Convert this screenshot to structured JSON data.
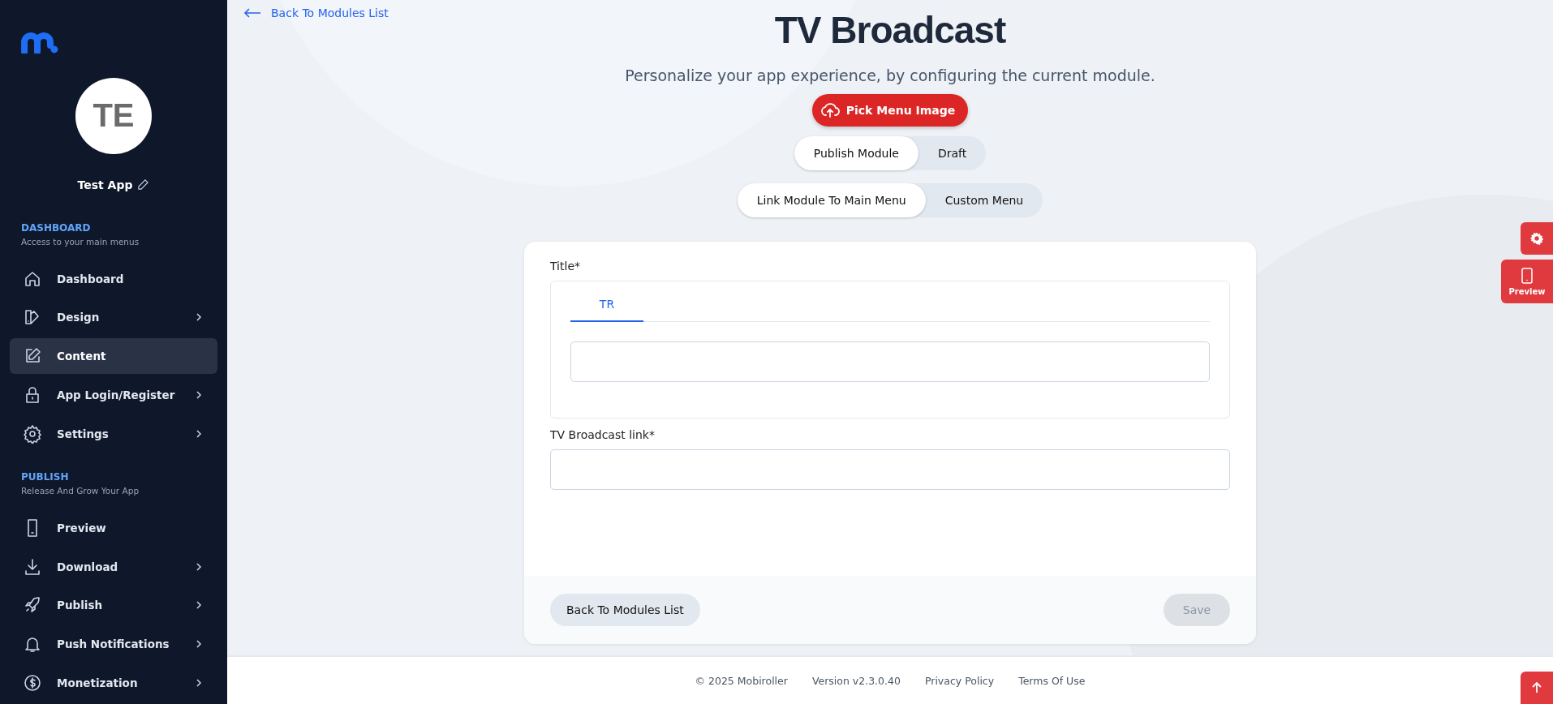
{
  "sidebar": {
    "app_avatar": "TE",
    "app_name": "Test App",
    "sections": [
      {
        "heading": "DASHBOARD",
        "subheading": "Access to your main menus",
        "items": [
          {
            "label": "Dashboard",
            "has_submenu": false,
            "selected": false
          },
          {
            "label": "Design",
            "has_submenu": true,
            "selected": false
          },
          {
            "label": "Content",
            "has_submenu": false,
            "selected": true
          },
          {
            "label": "App Login/Register",
            "has_submenu": true,
            "selected": false
          },
          {
            "label": "Settings",
            "has_submenu": true,
            "selected": false
          }
        ]
      },
      {
        "heading": "PUBLISH",
        "subheading": "Release And Grow Your App",
        "items": [
          {
            "label": "Preview",
            "has_submenu": false,
            "selected": false
          },
          {
            "label": "Download",
            "has_submenu": true,
            "selected": false
          },
          {
            "label": "Publish",
            "has_submenu": true,
            "selected": false
          },
          {
            "label": "Push Notifications",
            "has_submenu": true,
            "selected": false
          },
          {
            "label": "Monetization",
            "has_submenu": true,
            "selected": false
          }
        ]
      }
    ]
  },
  "back_link": "Back To Modules List",
  "title": "TV Broadcast",
  "subtitle": "Personalize your app experience, by configuring the current module.",
  "pick_image_button": "Pick Menu Image",
  "publish_toggle": [
    {
      "label": "Publish Module",
      "selected": true
    },
    {
      "label": "Draft",
      "selected": false
    }
  ],
  "menu_toggle": [
    {
      "label": "Link Module To Main Menu",
      "selected": true
    },
    {
      "label": "Custom Menu",
      "selected": false
    }
  ],
  "form": {
    "title_label": "Title*",
    "language_tabs": [
      {
        "label": "TR",
        "selected": true
      }
    ],
    "link_label": "TV Broadcast link*",
    "back_button": "Back To Modules List",
    "save_button": {
      "label": "Save",
      "disabled": true
    }
  },
  "side_tools": {
    "preview_label": "Preview"
  },
  "footer": [
    "© 2025 Mobiroller",
    "Version v2.3.0.40",
    "Privacy Policy",
    "Terms Of Use"
  ]
}
